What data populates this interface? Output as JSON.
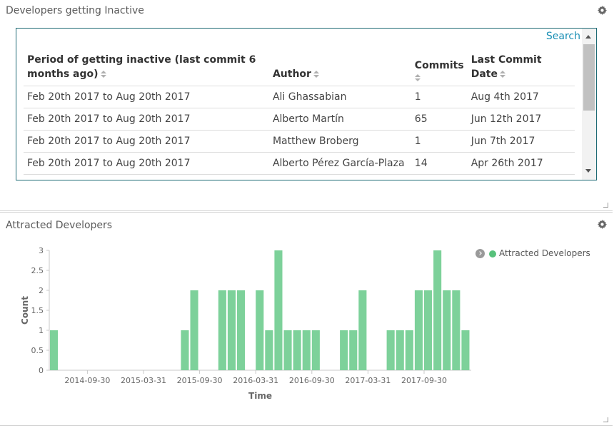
{
  "panel1": {
    "title": "Developers getting Inactive",
    "search_label": "Search",
    "columns": {
      "period": "Period of getting inactive (last commit 6 months ago)",
      "author": "Author",
      "commits": "Commits",
      "last_commit": "Last Commit Date"
    },
    "rows": [
      {
        "period": "Feb 20th 2017 to Aug 20th 2017",
        "author": "Ali Ghassabian",
        "commits": "1",
        "last_commit": "Aug 4th 2017"
      },
      {
        "period": "Feb 20th 2017 to Aug 20th 2017",
        "author": "Alberto Martín",
        "commits": "65",
        "last_commit": "Jun 12th 2017"
      },
      {
        "period": "Feb 20th 2017 to Aug 20th 2017",
        "author": "Matthew Broberg",
        "commits": "1",
        "last_commit": "Jun 7th 2017"
      },
      {
        "period": "Feb 20th 2017 to Aug 20th 2017",
        "author": "Alberto Pérez García-Plaza",
        "commits": "14",
        "last_commit": "Apr 26th 2017"
      }
    ]
  },
  "panel2": {
    "title": "Attracted Developers",
    "legend_label": "Attracted Developers"
  },
  "colors": {
    "bar": "#7dd19a",
    "legend_dot": "#57c17b",
    "link": "#1a8fb5",
    "table_border": "#1f6b75"
  },
  "chart_data": {
    "type": "bar",
    "xlabel": "Time",
    "ylabel": "Count",
    "ylim": [
      0,
      3
    ],
    "yticks": [
      "0",
      "0.5",
      "1",
      "1.5",
      "2",
      "2.5",
      "3"
    ],
    "xticks": [
      "2014-09-30",
      "2015-03-31",
      "2015-09-30",
      "2016-03-31",
      "2016-09-30",
      "2017-03-31",
      "2017-09-30"
    ],
    "legend": "top-right",
    "grid": false,
    "series": [
      {
        "name": "Attracted Developers",
        "x": [
          "2014-06",
          "2015-08",
          "2015-09",
          "2015-12",
          "2016-01",
          "2016-02",
          "2016-04",
          "2016-05",
          "2016-06",
          "2016-07",
          "2016-08",
          "2016-09",
          "2016-10",
          "2017-01",
          "2017-02",
          "2017-03",
          "2017-06",
          "2017-07",
          "2017-08",
          "2017-09",
          "2017-10",
          "2017-11",
          "2017-12",
          "2018-01",
          "2018-02"
        ],
        "values": [
          1,
          1,
          2,
          2,
          2,
          2,
          2,
          1,
          3,
          1,
          1,
          1,
          1,
          1,
          1,
          2,
          1,
          1,
          1,
          2,
          2,
          3,
          2,
          2,
          1
        ]
      }
    ]
  }
}
